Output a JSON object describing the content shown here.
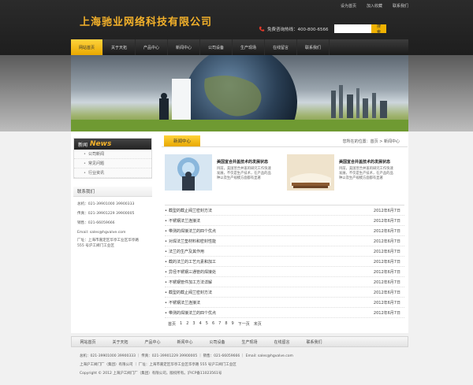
{
  "toplinks": [
    "设为首页",
    "加入收藏",
    "联系我们"
  ],
  "brand": "上海驰业网络科技有限公司",
  "hotline": "免费咨询热线：400-800-6566",
  "search": {
    "placeholder": "",
    "button": "搜索"
  },
  "nav": [
    "网站首页",
    "关于天拓",
    "产品中心",
    "新闻中心",
    "公司设备",
    "生产现场",
    "在线留言",
    "联系我们"
  ],
  "sidebar": {
    "head_cn": "新闻",
    "head_en": "News",
    "items": [
      "公司新闻",
      "常见问题",
      "行业资讯"
    ],
    "contact_title": "联系我们",
    "contact": [
      "总机：021-39901000 39900333",
      "传真：021-39901229 39900005",
      "销售：021-66059666",
      "Email: sales@hgvalve.com",
      "厂址：上海市嘉定区华亭工业区华亭路",
      "555 号沪工阀门工业区"
    ]
  },
  "content": {
    "tab": "新闻中心",
    "breadcrumb": "您所在的位置：首页 > 新闻中心",
    "features": [
      {
        "title": "美国宣合并盖技术的发展状态",
        "desc": "目前，美国宣合并盖的研究工作快速发展，不仅是生产技术，在产品的品种以及生产规模方面都有显著"
      },
      {
        "title": "美国宣合并盖技术的发展状态",
        "desc": "目前，美国宣合并盖的研究工作快速发展，不仅是生产技术，在产品的品种以及生产规模方面都有显著"
      }
    ],
    "news": [
      {
        "title": "截型的截止阀兰密封方法",
        "date": "2012年6月7日"
      },
      {
        "title": "不锈钢法兰连接法",
        "date": "2012年6月7日"
      },
      {
        "title": "带测的焊接法兰的四个优点",
        "date": "2012年6月7日"
      },
      {
        "title": "对焊法兰垫材料和密封性能",
        "date": "2012年6月7日"
      },
      {
        "title": "法兰的生产及其作用",
        "date": "2012年6月7日"
      },
      {
        "title": "截的法兰的工艺元素和加工",
        "date": "2012年6月7日"
      },
      {
        "title": "异径不锈钢三通管的焊接处",
        "date": "2012年6月7日"
      },
      {
        "title": "不锈钢管件加工方法详解",
        "date": "2012年6月7日"
      },
      {
        "title": "截型的截止阀兰密封方法",
        "date": "2012年6月7日"
      },
      {
        "title": "不锈钢法兰连接法",
        "date": "2012年6月7日"
      },
      {
        "title": "带测的焊接法兰的四个优点",
        "date": "2012年6月7日"
      }
    ],
    "pager": [
      "首页",
      "1",
      "2",
      "3",
      "4",
      "5",
      "6",
      "7",
      "8",
      "9",
      "下一页",
      "末页"
    ]
  },
  "footer": {
    "nav": [
      "网站首页",
      "关于天拓",
      "产品中心",
      "新闻中心",
      "公司设备",
      "生产现场",
      "在线留言",
      "联系我们"
    ],
    "line1": "总机：021-39901000 39900333 ｜ 传真：021-39901229 39900005 ｜ 销售：021-66059666 ｜ Email: sales@hgvalve.com",
    "line2": "上海沪工阀门厂（集团）有限公司 ｜ 厂址：上海市嘉定区华亭工业区华亭路 555 号沪工阀门工业区",
    "line3": "Copyright © 2012 上海沪工阀门厂（集团）有限公司，版权所有。沪ICP备11023561号"
  }
}
